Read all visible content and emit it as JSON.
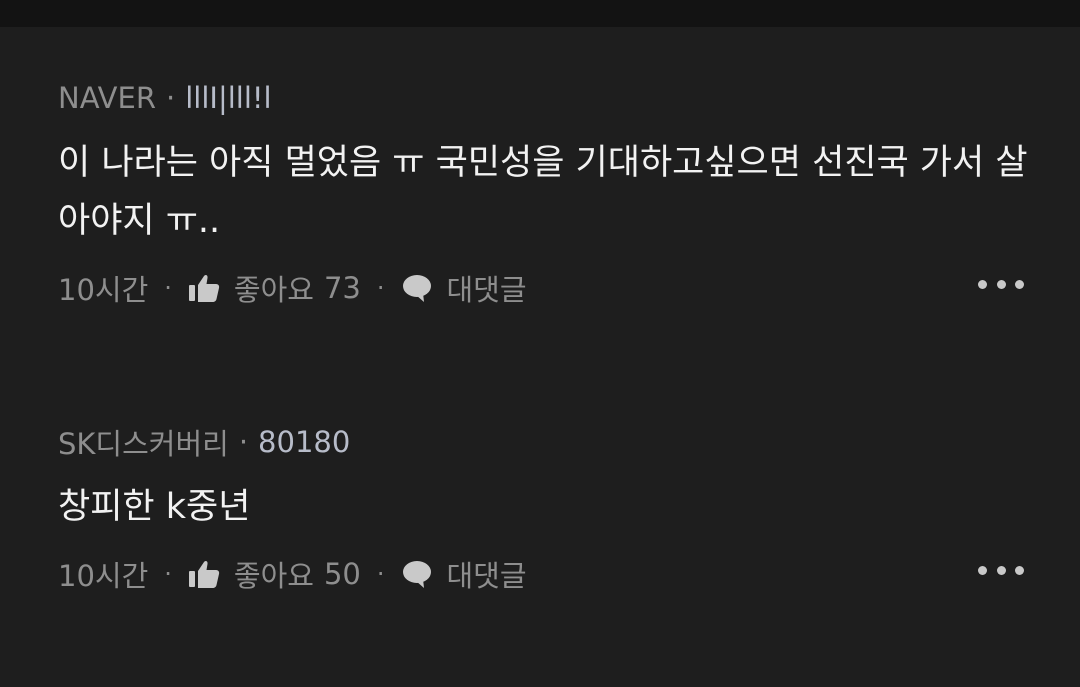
{
  "comments": [
    {
      "author": "NAVER",
      "user_id": "lllI|lll!l",
      "text": "이 나라는 아직 멀었음 ㅠ 국민성을 기대하고싶으면 선진국 가서 살아야지 ㅠ..",
      "time": "10시간",
      "like_label": "좋아요",
      "like_count": "73",
      "reply_label": "대댓글"
    },
    {
      "author": "SK디스커버리",
      "user_id": "80180",
      "text": "창피한 k중년",
      "time": "10시간",
      "like_label": "좋아요",
      "like_count": "50",
      "reply_label": "대댓글"
    }
  ],
  "separator": "·",
  "icons": {
    "like": "thumbs-up-icon",
    "reply": "speech-bubble-icon",
    "more": "more-horizontal-icon"
  },
  "colors": {
    "background": "#1e1e1e",
    "top_bar": "#131313",
    "body_text": "#f2f2f2",
    "meta_text": "#8e8e8e",
    "user_id": "#b7bcc9"
  }
}
